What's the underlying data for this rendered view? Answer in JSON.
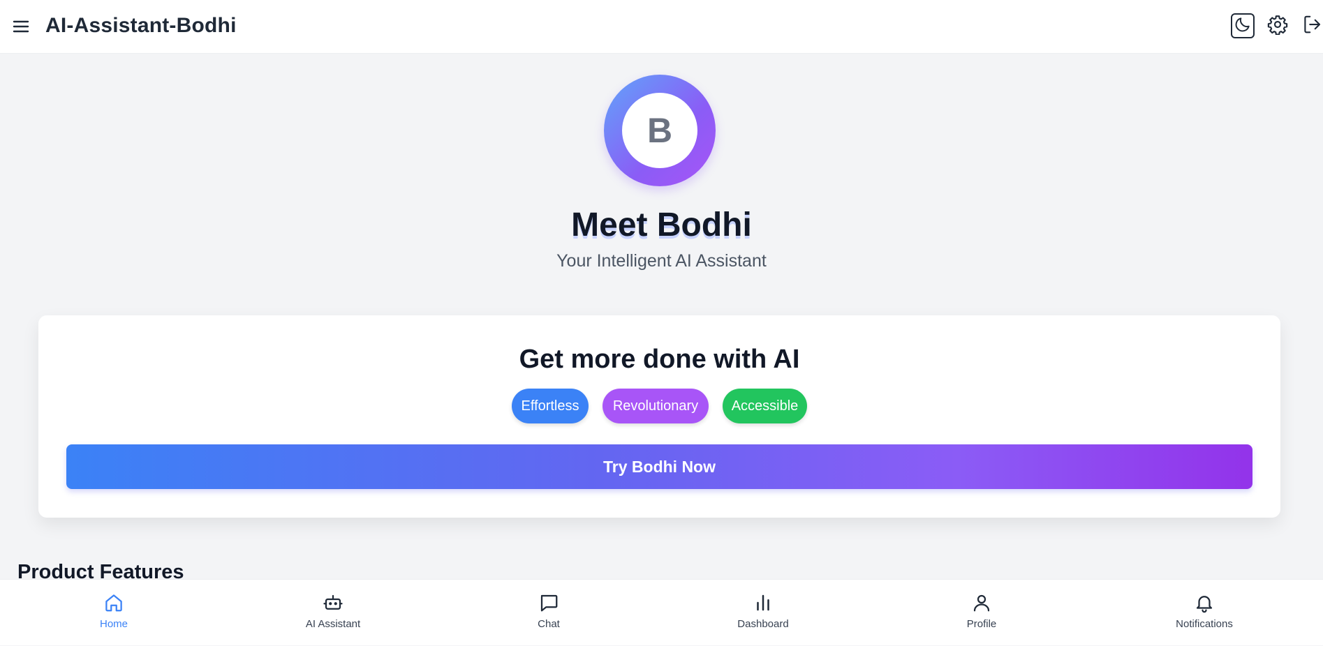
{
  "header": {
    "title": "AI-Assistant-Bodhi",
    "menu_icon": "hamburger-menu-icon",
    "actions": [
      "moon-icon",
      "gear-icon",
      "logout-icon"
    ]
  },
  "hero": {
    "avatar_letter": "B",
    "title": "Meet Bodhi",
    "subtitle": "Your Intelligent AI Assistant"
  },
  "card": {
    "title": "Get more done with AI",
    "tags": [
      "Effortless",
      "Revolutionary",
      "Accessible"
    ],
    "cta_label": "Try Bodhi Now"
  },
  "section": {
    "title": "Product Features"
  },
  "bottom_nav": {
    "items": [
      {
        "label": "Home",
        "icon": "home-icon",
        "active": true
      },
      {
        "label": "AI Assistant",
        "icon": "robot-icon"
      },
      {
        "label": "Chat",
        "icon": "chat-icon"
      },
      {
        "label": "Dashboard",
        "icon": "bar-chart-icon"
      },
      {
        "label": "Profile",
        "icon": "user-icon"
      },
      {
        "label": "Notifications",
        "icon": "bell-icon"
      }
    ]
  },
  "colors": {
    "accent_blue": "#3b82f6",
    "accent_purple": "#a855f7",
    "accent_green": "#22c55e"
  }
}
